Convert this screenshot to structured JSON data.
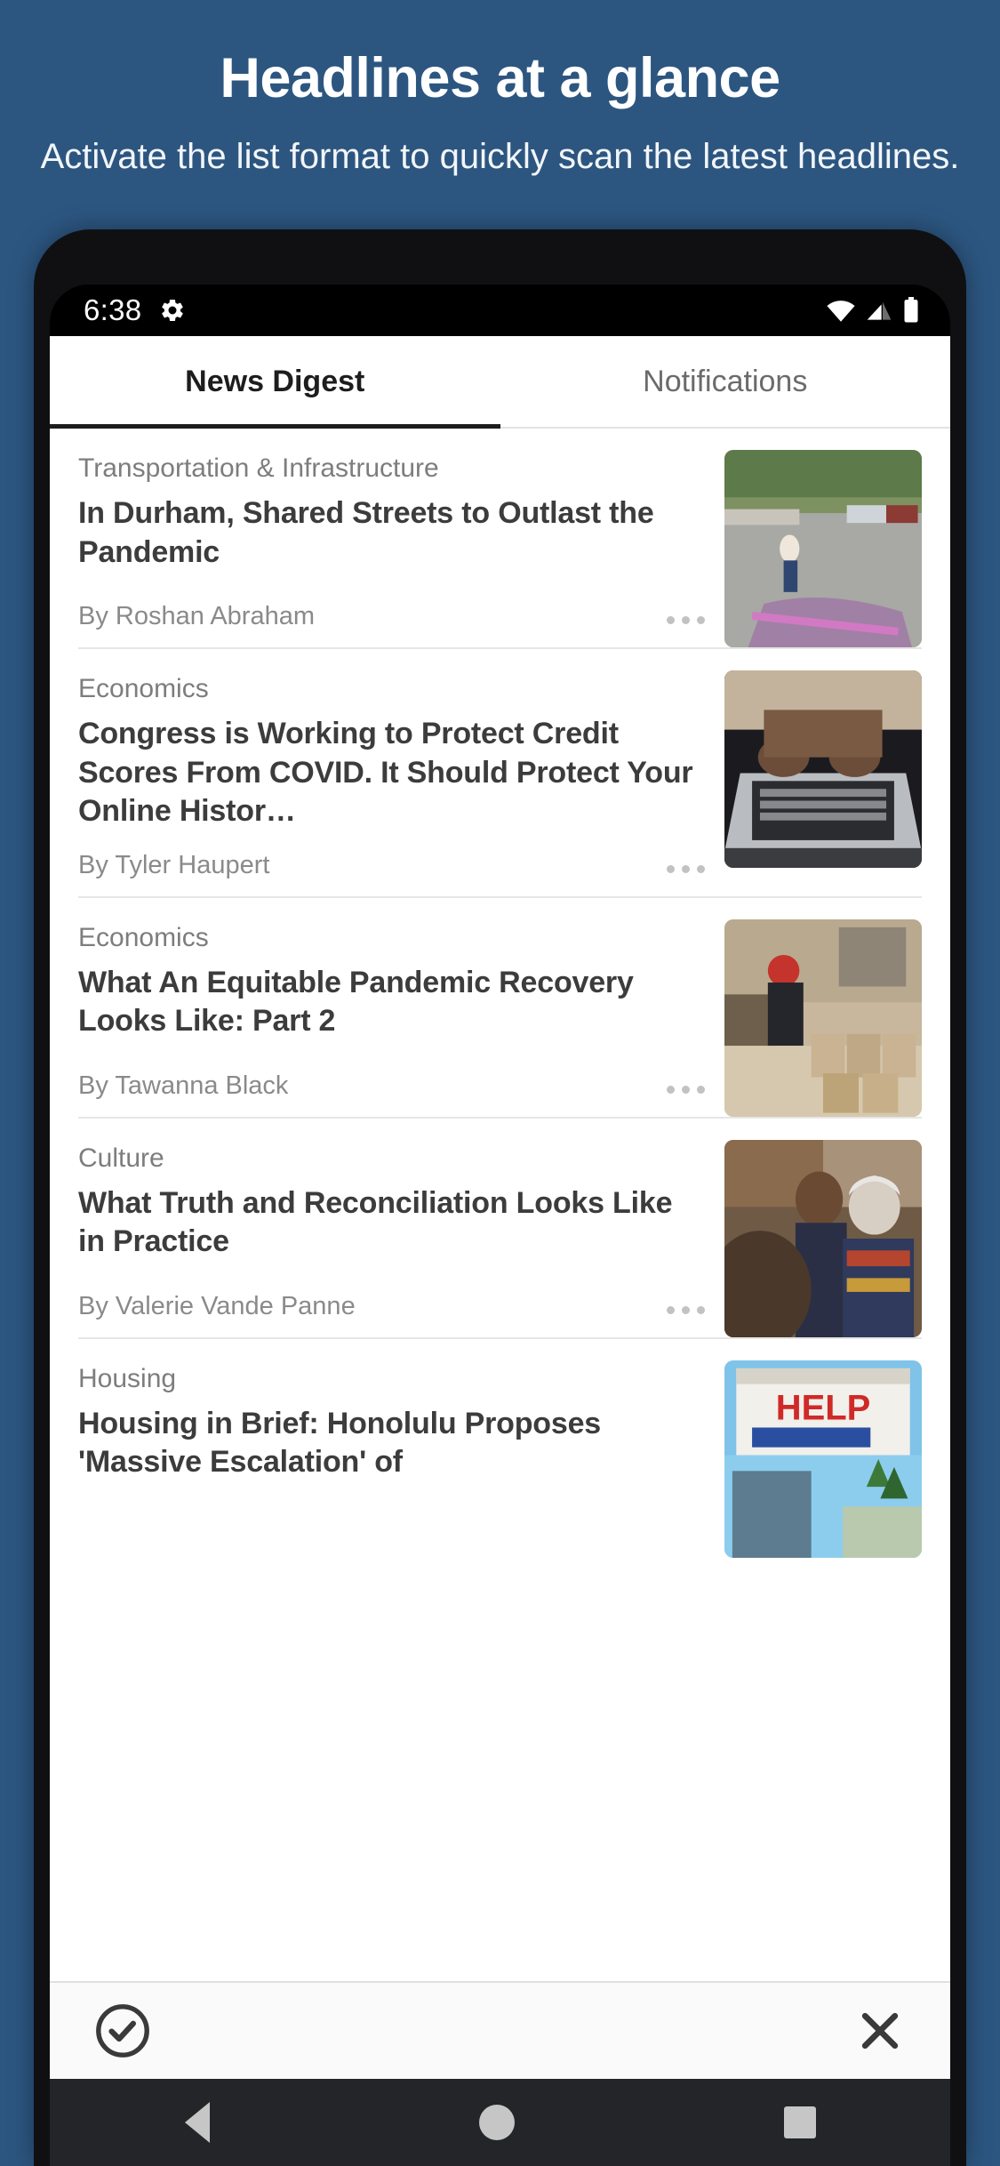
{
  "promo": {
    "title": "Headlines at a glance",
    "subtitle": "Activate the list format to quickly scan the latest headlines.",
    "background_color": "#2c5680",
    "text_color": "#ffffff"
  },
  "statusbar": {
    "time": "6:38",
    "left_icons": [
      "gear-icon"
    ],
    "right_icons": [
      "wifi-icon",
      "cellular-signal-icon",
      "battery-icon"
    ]
  },
  "tabs": [
    {
      "label": "News Digest",
      "active": true
    },
    {
      "label": "Notifications",
      "active": false
    }
  ],
  "articles": [
    {
      "category": "Transportation & Infrastructure",
      "title": "In Durham, Shared Streets to Outlast the Pandemic",
      "byline": "By Roshan Abraham",
      "menu": "more-options",
      "thumb": "street-mural-pedestrian"
    },
    {
      "category": "Economics",
      "title": "Congress is Working to Protect Credit Scores From COVID. It Should Protect Your Online Histor…",
      "byline": "By Tyler Haupert",
      "menu": "more-options",
      "thumb": "hands-on-laptop"
    },
    {
      "category": "Economics",
      "title": "What An Equitable Pandemic Recovery Looks Like: Part 2",
      "byline": "By Tawanna Black",
      "menu": "more-options",
      "thumb": "volunteer-food-boxes"
    },
    {
      "category": "Culture",
      "title": "What Truth and Reconciliation Looks Like in Practice",
      "byline": "By Valerie Vande Panne",
      "menu": "more-options",
      "thumb": "two-people-portrait"
    },
    {
      "category": "Housing",
      "title": "Housing in Brief: Honolulu Proposes 'Massive Escalation' of",
      "byline": "",
      "menu": "more-options",
      "thumb": "help-the-homeless-sign"
    }
  ],
  "actionbar": {
    "confirm_icon": "check-circle-icon",
    "close_icon": "close-icon"
  },
  "navbar": {
    "back": "back-triangle-icon",
    "home": "home-circle-icon",
    "recents": "recents-square-icon"
  }
}
